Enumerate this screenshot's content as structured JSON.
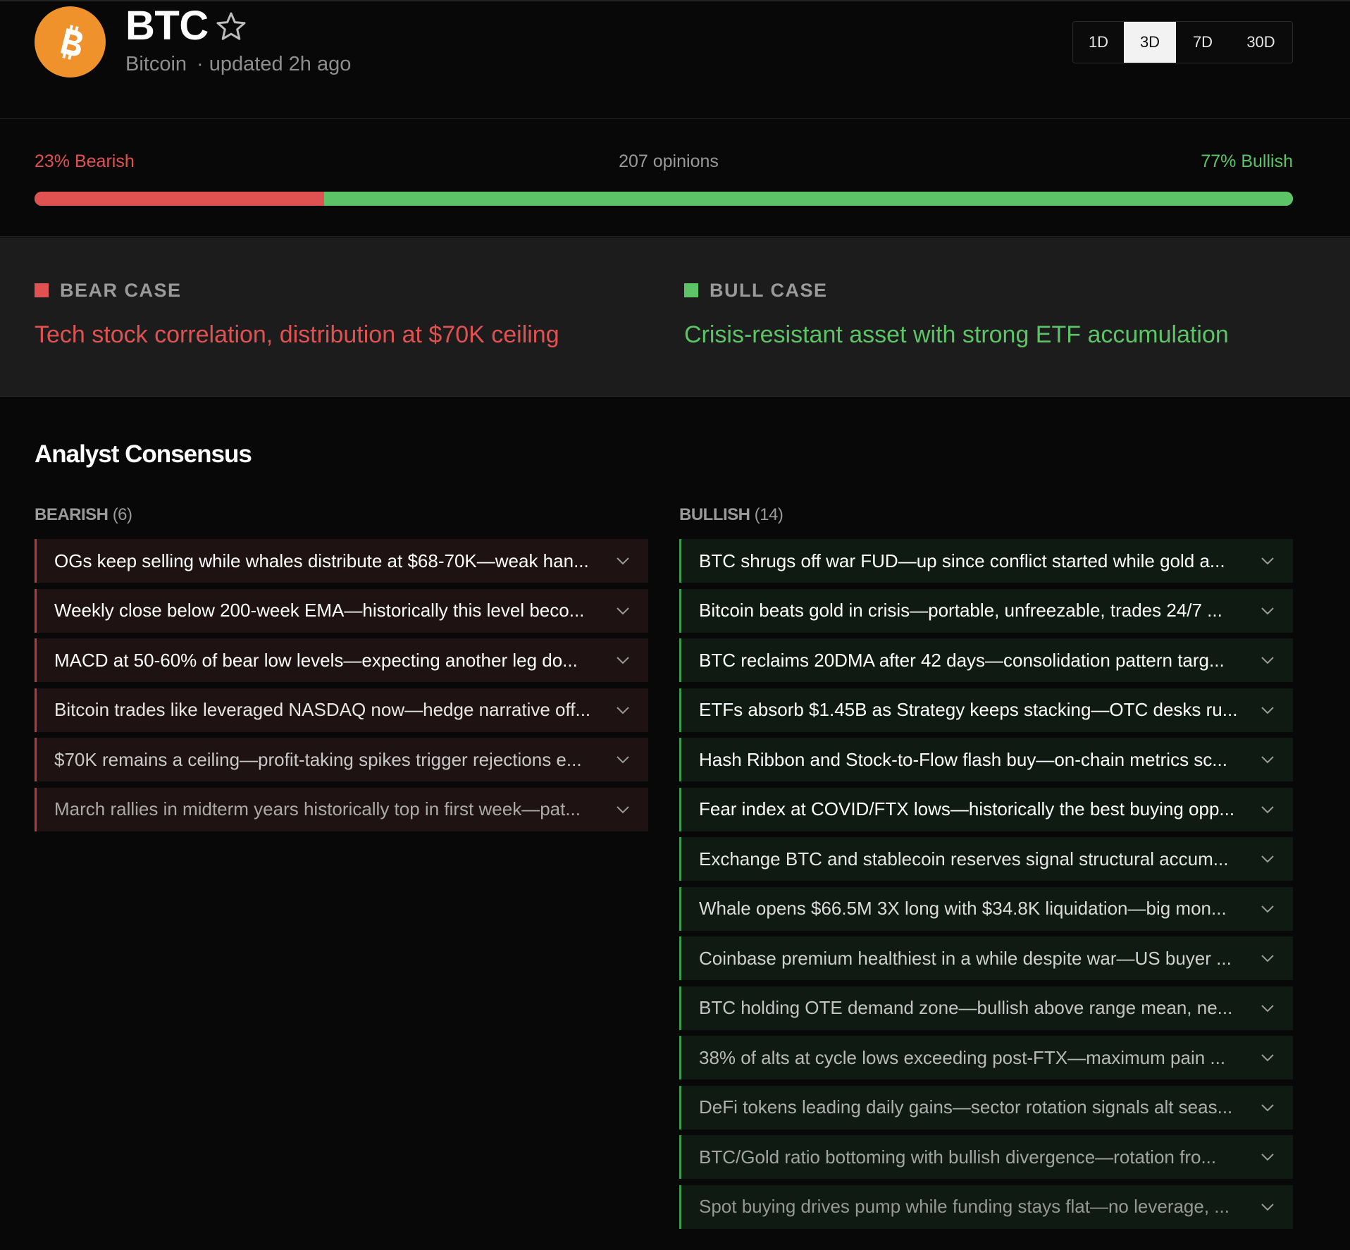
{
  "header": {
    "symbol": "BTC",
    "name": "Bitcoin",
    "updated": "· updated 2h ago",
    "range_tabs": [
      "1D",
      "3D",
      "7D",
      "30D"
    ],
    "active_range": "3D"
  },
  "sentiment": {
    "bearish_label": "23% Bearish",
    "bullish_label": "77% Bullish",
    "opinions_label": "207 opinions",
    "bearish_fraction": 0.23,
    "colors": {
      "bearish": "#e05252",
      "bullish": "#5cc466"
    }
  },
  "cases": {
    "bear": {
      "heading": "BEAR CASE",
      "text": "Tech stock correlation, distribution at $70K ceiling"
    },
    "bull": {
      "heading": "BULL CASE",
      "text": "Crisis-resistant asset with strong ETF accumulation"
    }
  },
  "consensus": {
    "title": "Analyst Consensus",
    "bearish": {
      "label": "BEARISH",
      "count": "(6)",
      "items": [
        "OGs keep selling while whales distribute at $68-70K—weak han...",
        "Weekly close below 200-week EMA—historically this level beco...",
        "MACD at 50-60% of bear low levels—expecting another leg do...",
        "Bitcoin trades like leveraged NASDAQ now—hedge narrative off...",
        "$70K remains a ceiling—profit-taking spikes trigger rejections e...",
        "March rallies in midterm years historically top in first week—pat..."
      ]
    },
    "bullish": {
      "label": "BULLISH",
      "count": "(14)",
      "items": [
        "BTC shrugs off war FUD—up since conflict started while gold a...",
        "Bitcoin beats gold in crisis—portable, unfreezable, trades 24/7 ...",
        "BTC reclaims 20DMA after 42 days—consolidation pattern targ...",
        "ETFs absorb $1.45B as Strategy keeps stacking—OTC desks ru...",
        "Hash Ribbon and Stock-to-Flow flash buy—on-chain metrics sc...",
        "Fear index at COVID/FTX lows—historically the best buying opp...",
        "Exchange BTC and stablecoin reserves signal structural accum...",
        "Whale opens $66.5M 3X long with $34.8K liquidation—big mon...",
        "Coinbase premium healthiest in a while despite war—US buyer ...",
        "BTC holding OTE demand zone—bullish above range mean, ne...",
        "38% of alts at cycle lows exceeding post-FTX—maximum pain ...",
        "DeFi tokens leading daily gains—sector rotation signals alt seas...",
        "BTC/Gold ratio bottoming with bullish divergence—rotation fro...",
        "Spot buying drives pump while funding stays flat—no leverage, ..."
      ]
    }
  }
}
